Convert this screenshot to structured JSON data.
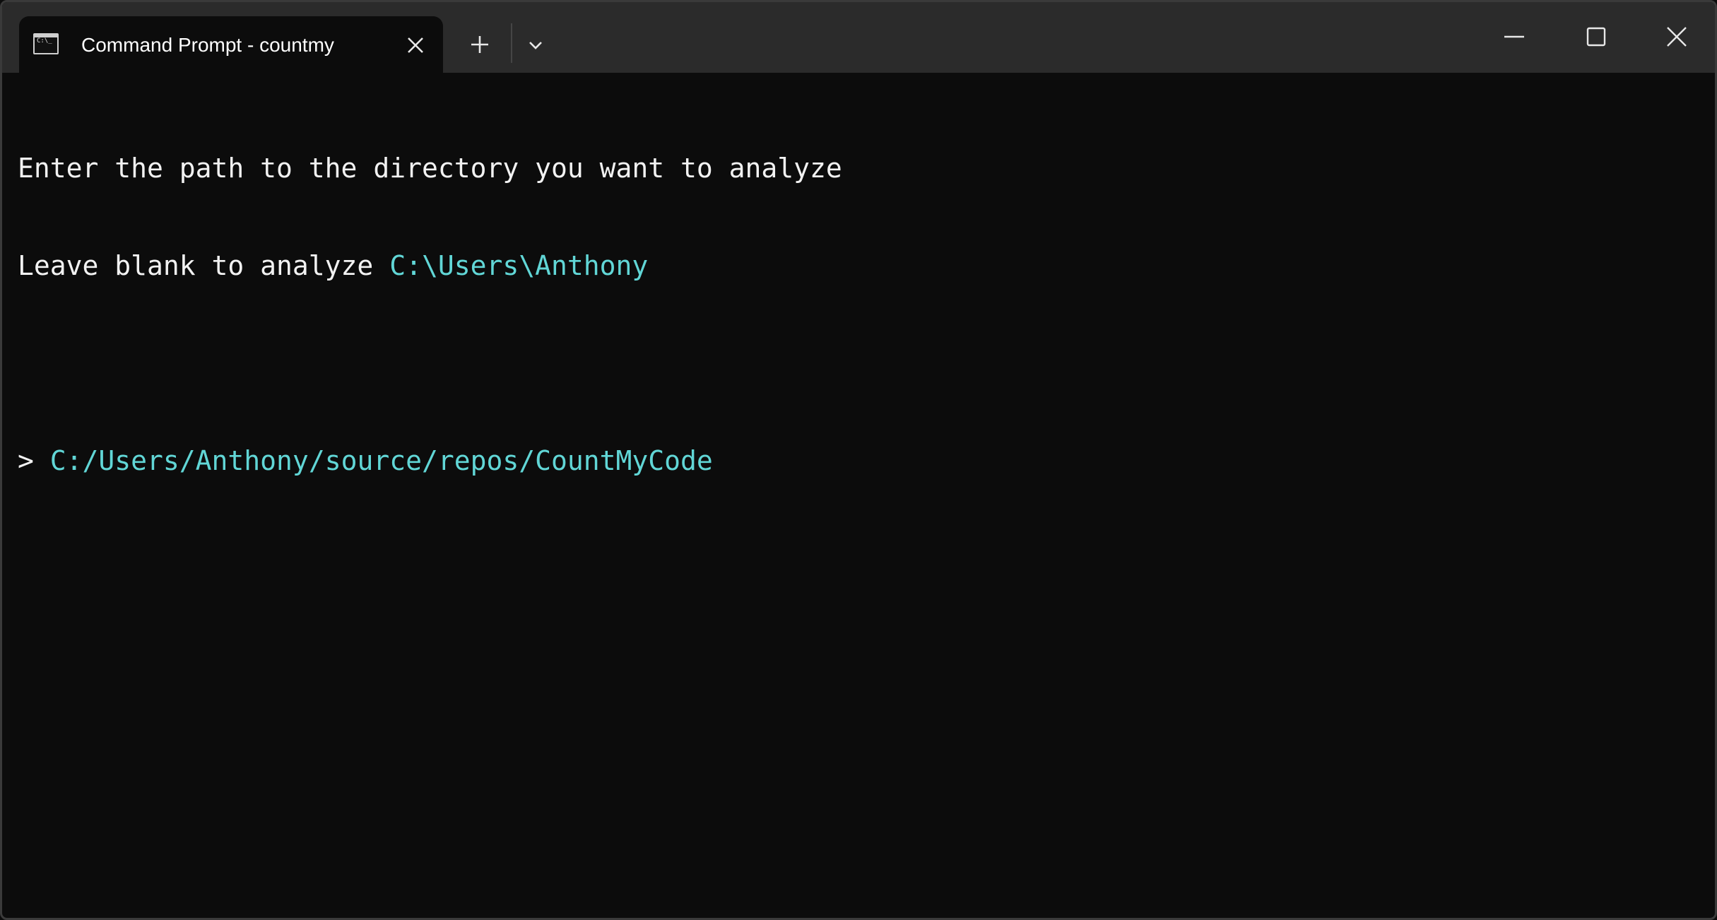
{
  "window": {
    "tab_title": "Command Prompt - countmy",
    "icons": {
      "tab_icon": "cmd-icon",
      "tab_close": "close-icon",
      "new_tab": "plus-icon",
      "dropdown": "chevron-down-icon",
      "minimize": "minimize-icon",
      "maximize": "maximize-icon",
      "close": "close-icon"
    }
  },
  "console": {
    "line1": "Enter the path to the directory you want to analyze",
    "line2_text": "Leave blank to analyze ",
    "line2_path": "C:\\Users\\Anthony",
    "prompt_symbol": "> ",
    "input_value": "C:/Users/Anthony/source/repos/CountMyCode"
  },
  "colors": {
    "background": "#0c0c0c",
    "titlebar": "#2b2b2b",
    "text": "#f2f2f2",
    "accent_cyan": "#61d6d6"
  }
}
